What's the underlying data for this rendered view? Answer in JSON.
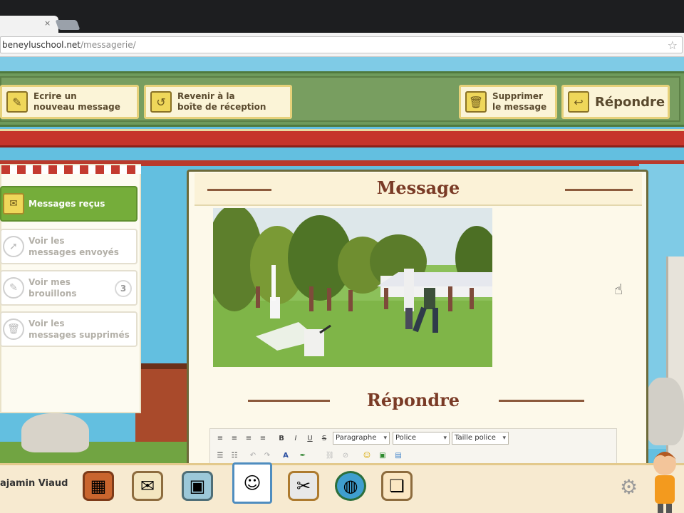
{
  "browser": {
    "url_domain": "beneyluschool.net",
    "url_path": "/messagerie/",
    "tab_close": "×"
  },
  "toolbar": {
    "write_label": "Ecrire un\nnouveau message",
    "back_label": "Revenir à la\nboîte de réception",
    "delete_label": "Supprimer\nle message",
    "reply_label": "Répondre"
  },
  "sidebar": {
    "items": [
      {
        "label": "Messages reçus",
        "active": true
      },
      {
        "label": "Voir les\nmessages envoyés",
        "active": false
      },
      {
        "label": "Voir mes\nbrouillons",
        "badge": "3",
        "active": false
      },
      {
        "label": "Voir les\nmessages supprimés",
        "active": false
      }
    ]
  },
  "message": {
    "title": "Message",
    "reply_title": "Répondre"
  },
  "editor": {
    "format_select": "Paragraphe",
    "font_select": "Police",
    "size_select": "Taille police"
  },
  "bottombar": {
    "user_name": "ajamin Viaud"
  },
  "colors": {
    "toolbar_green": "#6e9a5b",
    "accent_red": "#c6342b",
    "title_brown": "#7a3b26",
    "active_green": "#75ad3a"
  },
  "icons": [
    "star-icon",
    "pencil-icon",
    "return-icon",
    "trash-icon",
    "reply-icon",
    "inbox-icon",
    "sent-icon",
    "draft-icon",
    "deleted-icon",
    "gear-icon"
  ]
}
